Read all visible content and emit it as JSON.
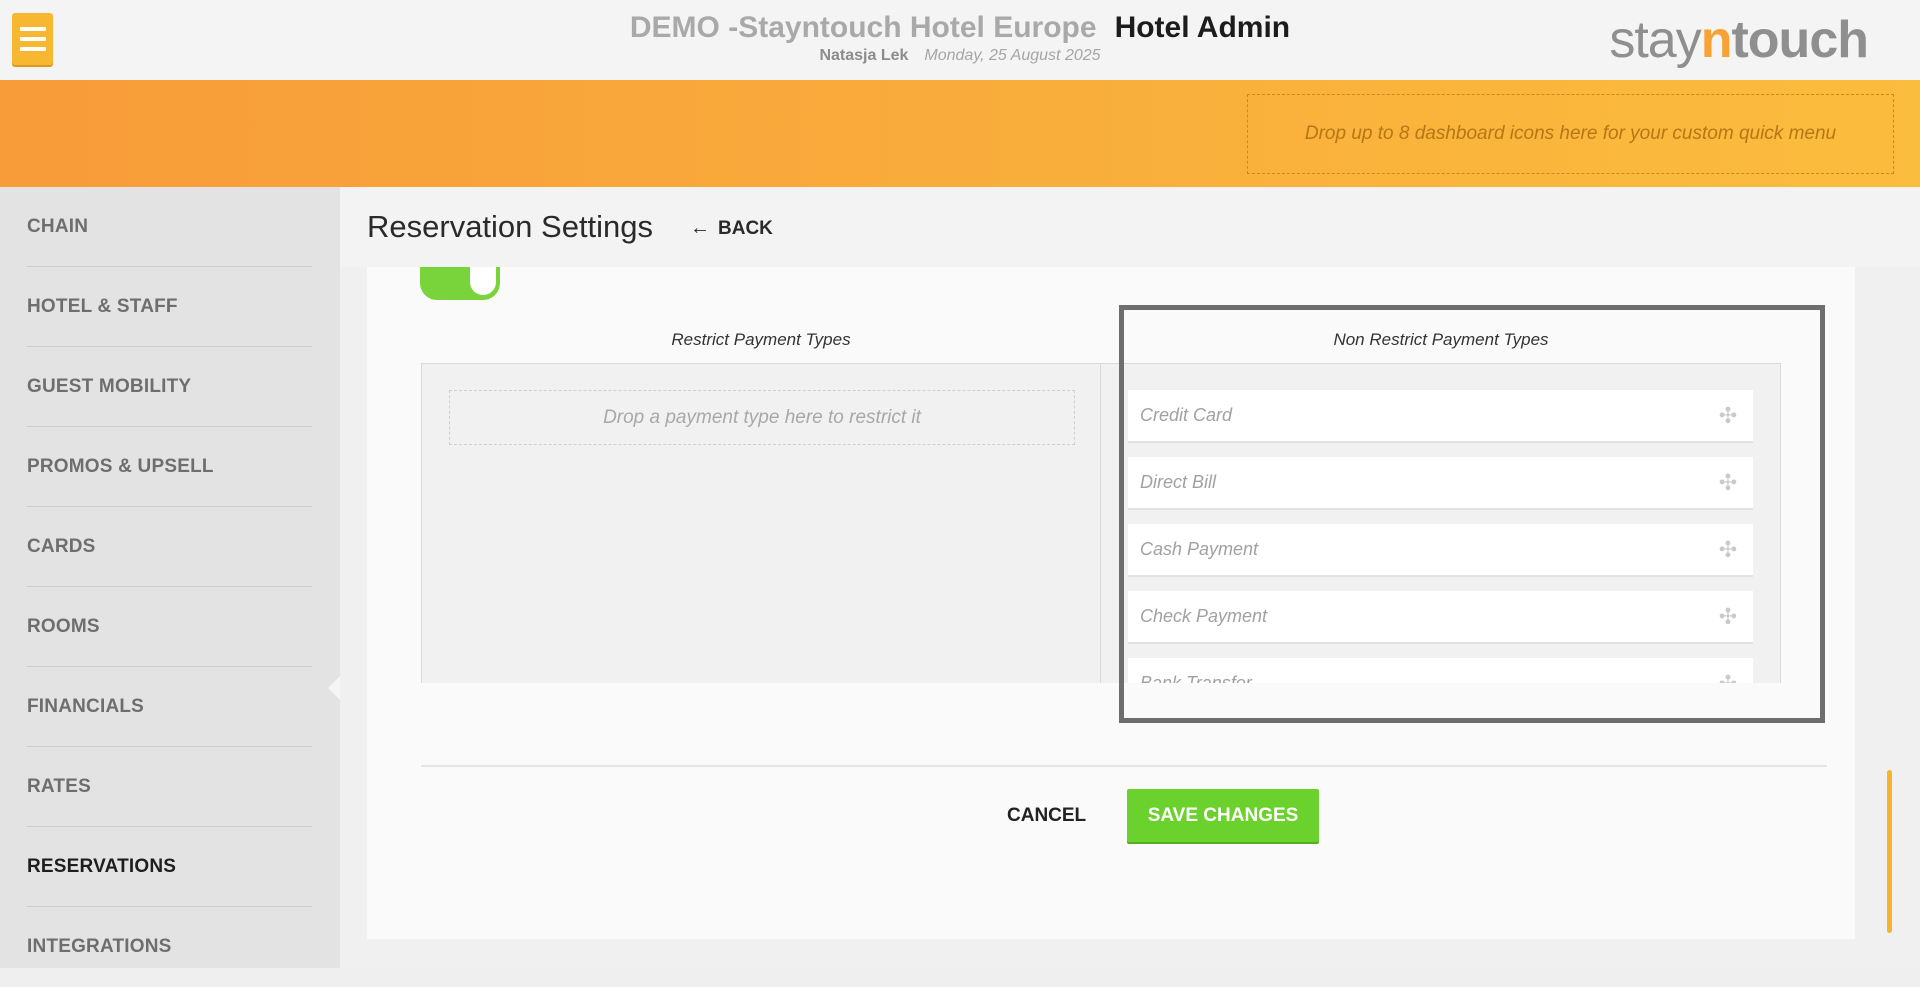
{
  "header": {
    "hotel_name": "DEMO -Stayntouch Hotel Europe",
    "app_name": "Hotel Admin",
    "user_name": "Natasja Lek",
    "date": "Monday, 25 August 2025",
    "logo": {
      "part1": "stay",
      "part2": "n",
      "part3": "touch"
    }
  },
  "banner": {
    "quick_menu_hint": "Drop up to 8 dashboard icons here for your custom quick menu"
  },
  "sidebar": {
    "items": [
      {
        "label": "CHAIN"
      },
      {
        "label": "HOTEL & STAFF"
      },
      {
        "label": "GUEST MOBILITY"
      },
      {
        "label": "PROMOS & UPSELL"
      },
      {
        "label": "CARDS"
      },
      {
        "label": "ROOMS"
      },
      {
        "label": "FINANCIALS"
      },
      {
        "label": "RATES"
      },
      {
        "label": "RESERVATIONS"
      },
      {
        "label": "INTEGRATIONS"
      }
    ],
    "active": "RESERVATIONS"
  },
  "page": {
    "title": "Reservation Settings",
    "back_label": "BACK",
    "toggle_on": true,
    "restrict_title": "Restrict Payment Types",
    "restrict_drop_hint": "Drop a payment type here to restrict it",
    "nonrestrict_title": "Non Restrict Payment Types",
    "payment_types": [
      {
        "label": "Credit Card"
      },
      {
        "label": "Direct Bill"
      },
      {
        "label": "Cash Payment"
      },
      {
        "label": "Check Payment"
      },
      {
        "label": "Bank Transfer"
      }
    ],
    "cancel_label": "CANCEL",
    "save_label": "SAVE CHANGES"
  },
  "colors": {
    "accent_orange": "#f89b39",
    "save_green": "#6bd22d",
    "toggle_green": "#79d33a"
  }
}
